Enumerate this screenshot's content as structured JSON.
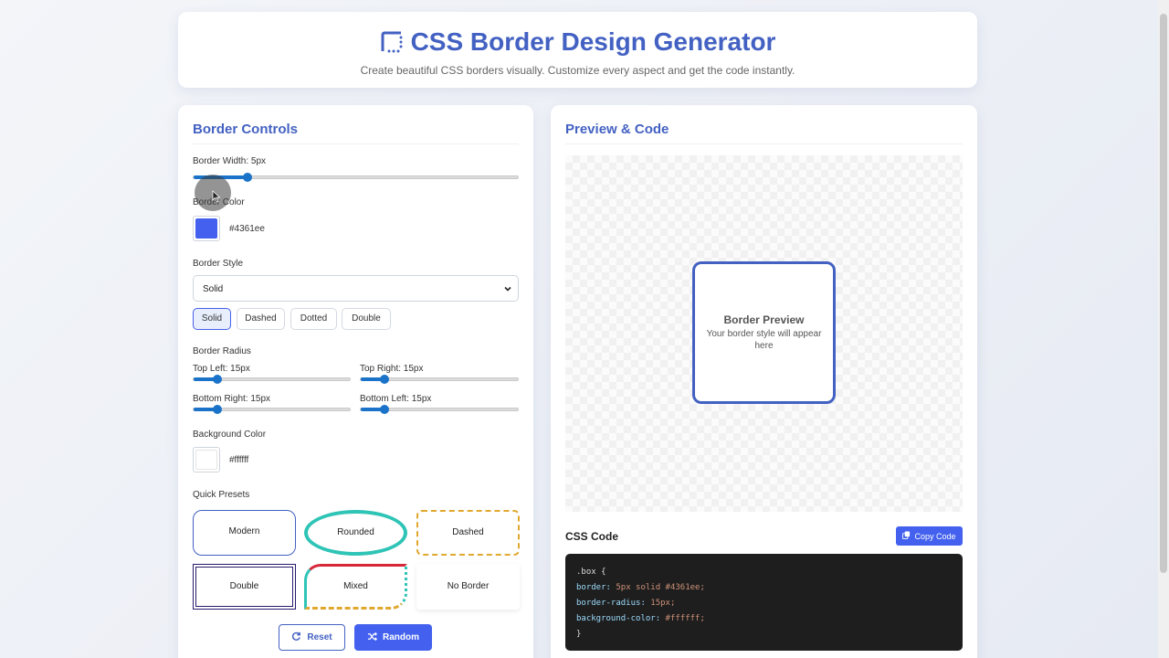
{
  "header": {
    "title": "CSS Border Design Generator",
    "subtitle": "Create beautiful CSS borders visually. Customize every aspect and get the code instantly.",
    "logo_icon": "border-style-icon"
  },
  "controls": {
    "title": "Border Controls",
    "border_width": {
      "label": "Border Width: 5px",
      "value": 5,
      "min": 0,
      "max": 30
    },
    "border_color": {
      "label": "Border Color",
      "hex": "#4361ee"
    },
    "border_style": {
      "label": "Border Style",
      "selected": "Solid",
      "buttons": [
        "Solid",
        "Dashed",
        "Dotted",
        "Double"
      ]
    },
    "border_radius": {
      "label": "Border Radius",
      "top_left": {
        "label": "Top Left: 15px",
        "value": 15,
        "max": 100
      },
      "top_right": {
        "label": "Top Right: 15px",
        "value": 15,
        "max": 100
      },
      "bottom_right": {
        "label": "Bottom Right: 15px",
        "value": 15,
        "max": 100
      },
      "bottom_left": {
        "label": "Bottom Left: 15px",
        "value": 15,
        "max": 100
      }
    },
    "background_color": {
      "label": "Background Color",
      "hex": "#ffffff"
    },
    "quick_presets": {
      "label": "Quick Presets",
      "items": [
        "Modern",
        "Rounded",
        "Dashed",
        "Double",
        "Mixed",
        "No Border"
      ]
    },
    "reset_label": "Reset",
    "random_label": "Random"
  },
  "preview": {
    "title": "Preview & Code",
    "box_title": "Border Preview",
    "box_subtitle": "Your border style will appear here"
  },
  "code": {
    "title": "CSS Code",
    "copy_label": "Copy Code",
    "selector": ".box {",
    "border_prop": "border:",
    "border_val": "5px solid #4361ee;",
    "radius_prop": "border-radius:",
    "radius_val": "15px;",
    "bg_prop": "background-color:",
    "bg_val": "#ffffff;",
    "close": "}"
  },
  "colors": {
    "accent": "#4361ee",
    "heading": "#4361c2",
    "slider": "#1a73c9"
  }
}
